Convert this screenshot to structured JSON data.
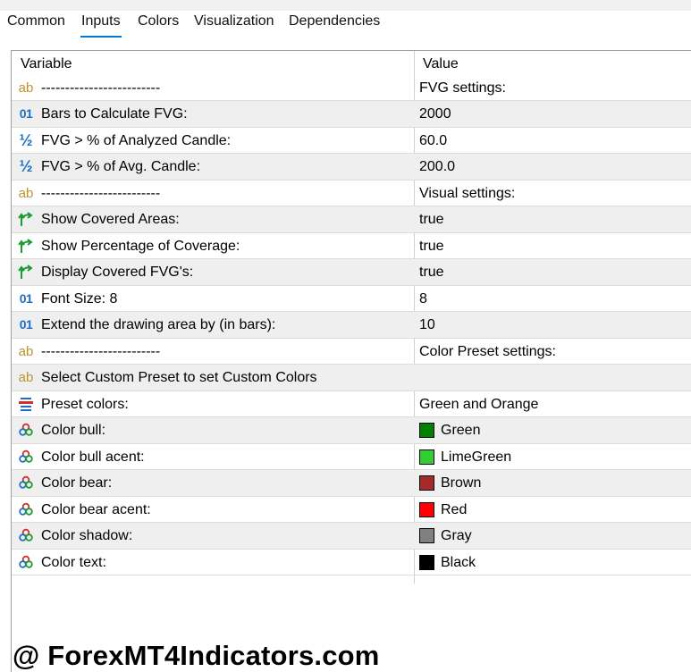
{
  "tabs": [
    {
      "label": "Common"
    },
    {
      "label": "Inputs"
    },
    {
      "label": "Colors"
    },
    {
      "label": "Visualization"
    },
    {
      "label": "Dependencies"
    }
  ],
  "active_tab": "Inputs",
  "table": {
    "col_variable": "Variable",
    "col_value": "Value",
    "rows": [
      {
        "icon": "string-icon",
        "variable": "-------------------------",
        "value": "FVG settings:"
      },
      {
        "icon": "integer-icon",
        "variable": "Bars to Calculate FVG:",
        "value": "2000"
      },
      {
        "icon": "double-icon",
        "variable": "FVG > % of Analyzed Candle:",
        "value": "60.0"
      },
      {
        "icon": "double-icon",
        "variable": "FVG > % of Avg. Candle:",
        "value": "200.0"
      },
      {
        "icon": "string-icon",
        "variable": "-------------------------",
        "value": "Visual settings:"
      },
      {
        "icon": "bool-icon",
        "variable": "Show Covered Areas:",
        "value": "true"
      },
      {
        "icon": "bool-icon",
        "variable": "Show Percentage of Coverage:",
        "value": "true"
      },
      {
        "icon": "bool-icon",
        "variable": "Display Covered FVG's:",
        "value": "true"
      },
      {
        "icon": "integer-icon",
        "variable": "Font Size: 8",
        "value": "8"
      },
      {
        "icon": "integer-icon",
        "variable": "Extend the drawing area by (in bars):",
        "value": "10"
      },
      {
        "icon": "string-icon",
        "variable": "-------------------------",
        "value": "Color Preset settings:"
      },
      {
        "icon": "string-icon",
        "variable": "Select Custom Preset to set Custom Colors",
        "value": ""
      },
      {
        "icon": "enum-icon",
        "variable": "Preset colors:",
        "value": "Green and Orange"
      },
      {
        "icon": "color-icon",
        "variable": "Color bull:",
        "value": "Green",
        "color": "#008000"
      },
      {
        "icon": "color-icon",
        "variable": "Color bull acent:",
        "value": "LimeGreen",
        "color": "#32cd32"
      },
      {
        "icon": "color-icon",
        "variable": "Color bear:",
        "value": "Brown",
        "color": "#a52a2a"
      },
      {
        "icon": "color-icon",
        "variable": "Color bear acent:",
        "value": "Red",
        "color": "#ff0000"
      },
      {
        "icon": "color-icon",
        "variable": "Color shadow:",
        "value": "Gray",
        "color": "#808080"
      },
      {
        "icon": "color-icon",
        "variable": "Color text:",
        "value": "Black",
        "color": "#000000"
      }
    ]
  },
  "watermark": "@ ForexMT4Indicators.com"
}
